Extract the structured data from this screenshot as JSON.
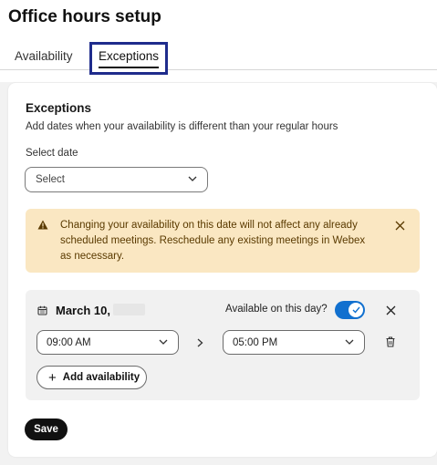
{
  "page": {
    "title": "Office hours setup"
  },
  "tabs": [
    {
      "label": "Availability",
      "active": false
    },
    {
      "label": "Exceptions",
      "active": true
    }
  ],
  "exceptions": {
    "title": "Exceptions",
    "description": "Add dates when your availability is different than your regular hours",
    "select_label": "Select date",
    "select_value": "Select"
  },
  "warning": {
    "text": "Changing your availability on this date will not affect any already scheduled meetings. Reschedule any existing meetings in Webex as necessary.",
    "background": "#fae7c2"
  },
  "exception_entry": {
    "date": "March 10,",
    "available_label": "Available on this day?",
    "available": true,
    "start_time": "09:00 AM",
    "end_time": "05:00 PM",
    "add_availability_label": "Add availability"
  },
  "actions": {
    "save_label": "Save"
  },
  "colors": {
    "accent": "#1170cf",
    "tab_focus": "#1f2c8c"
  },
  "icons": [
    "calendar-icon",
    "warning-icon",
    "close-icon",
    "chevron-down-icon",
    "chevron-right-icon",
    "trash-icon",
    "plus-icon",
    "check-icon"
  ]
}
